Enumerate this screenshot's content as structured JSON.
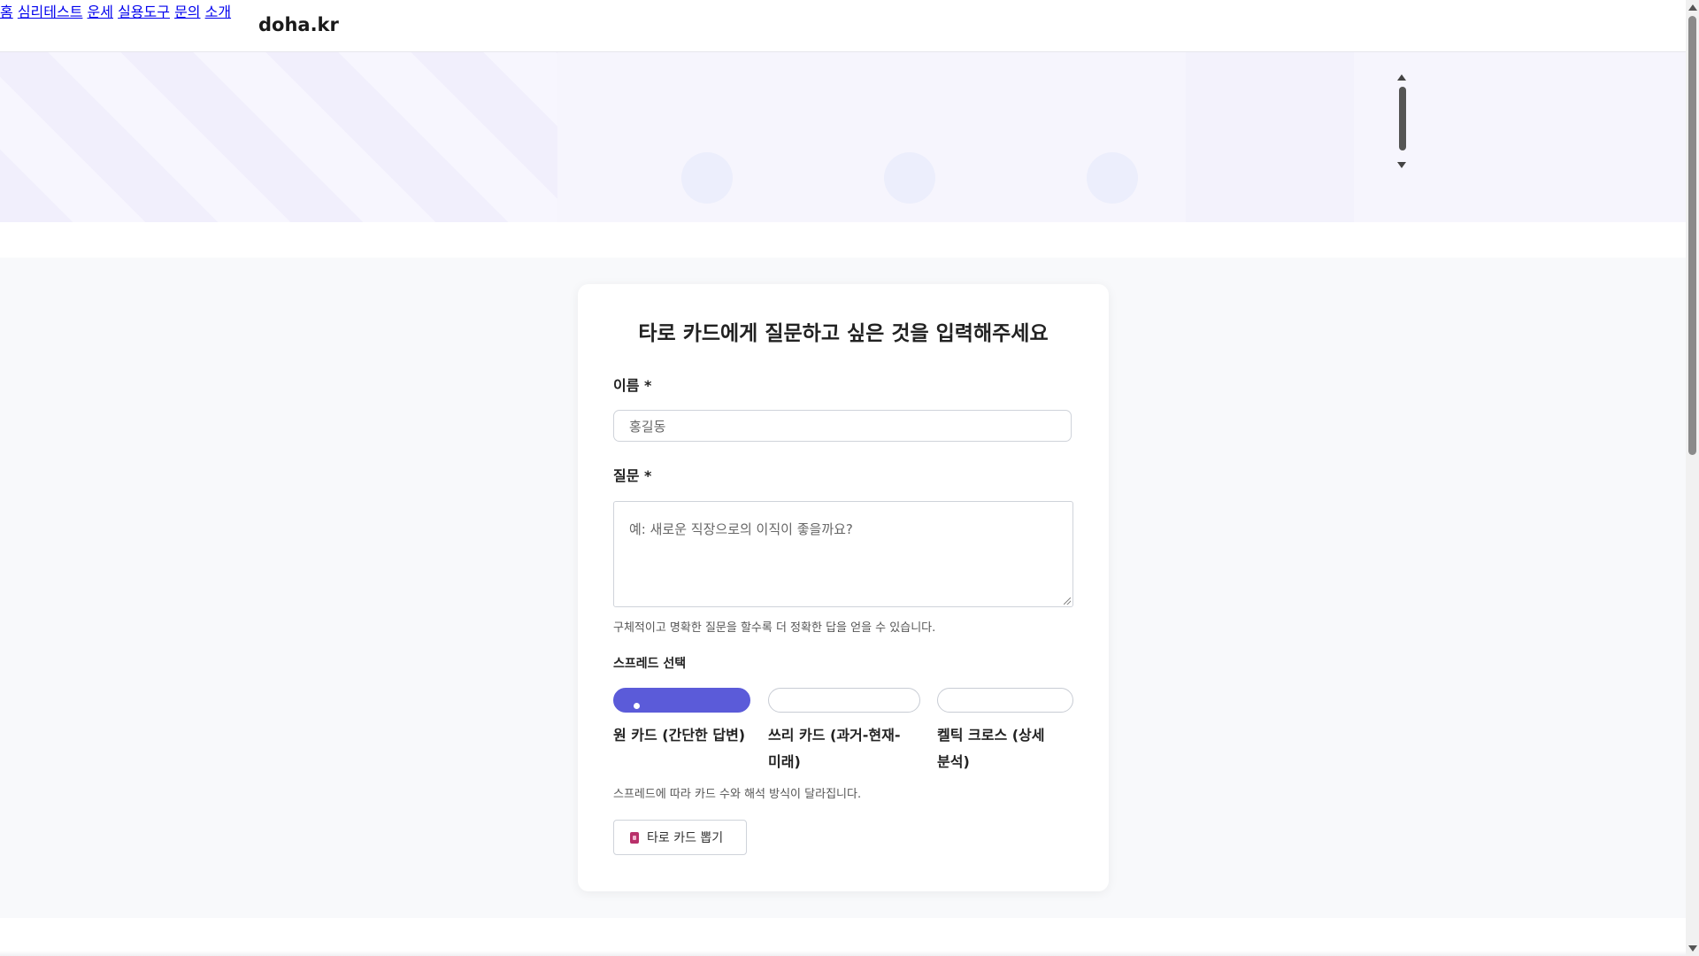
{
  "header": {
    "logo": "doha.kr",
    "nav": [
      "홈",
      "심리테스트",
      "운세",
      "실용도구",
      "문의",
      "소개"
    ]
  },
  "form": {
    "title": "타로 카드에게 질문하고 싶은 것을 입력해주세요",
    "name_label": "이름 *",
    "name_placeholder": "홍길동",
    "question_label": "질문 *",
    "question_placeholder": "예: 새로운 직장으로의 이직이 좋을까요?",
    "question_help": "구체적이고 명확한 질문을 할수록 더 정확한 답을 얻을 수 있습니다.",
    "spread_label": "스프레드 선택",
    "spreads": [
      {
        "label": "원 카드 (간단한 답변)",
        "selected": true
      },
      {
        "label": "쓰리 카드 (과거-현재-미래)",
        "selected": false
      },
      {
        "label": "켈틱 크로스 (상세 분석)",
        "selected": false
      }
    ],
    "spread_help": "스프레드에 따라 카드 수와 해석 방식이 달라집니다.",
    "submit_label": "타로 카드 뽑기",
    "submit_icon": "tarot-card-icon"
  },
  "colors": {
    "accent": "#5b5bd9",
    "hero_bg": "#f6f5fd",
    "section_bg": "#f8f9fb"
  }
}
